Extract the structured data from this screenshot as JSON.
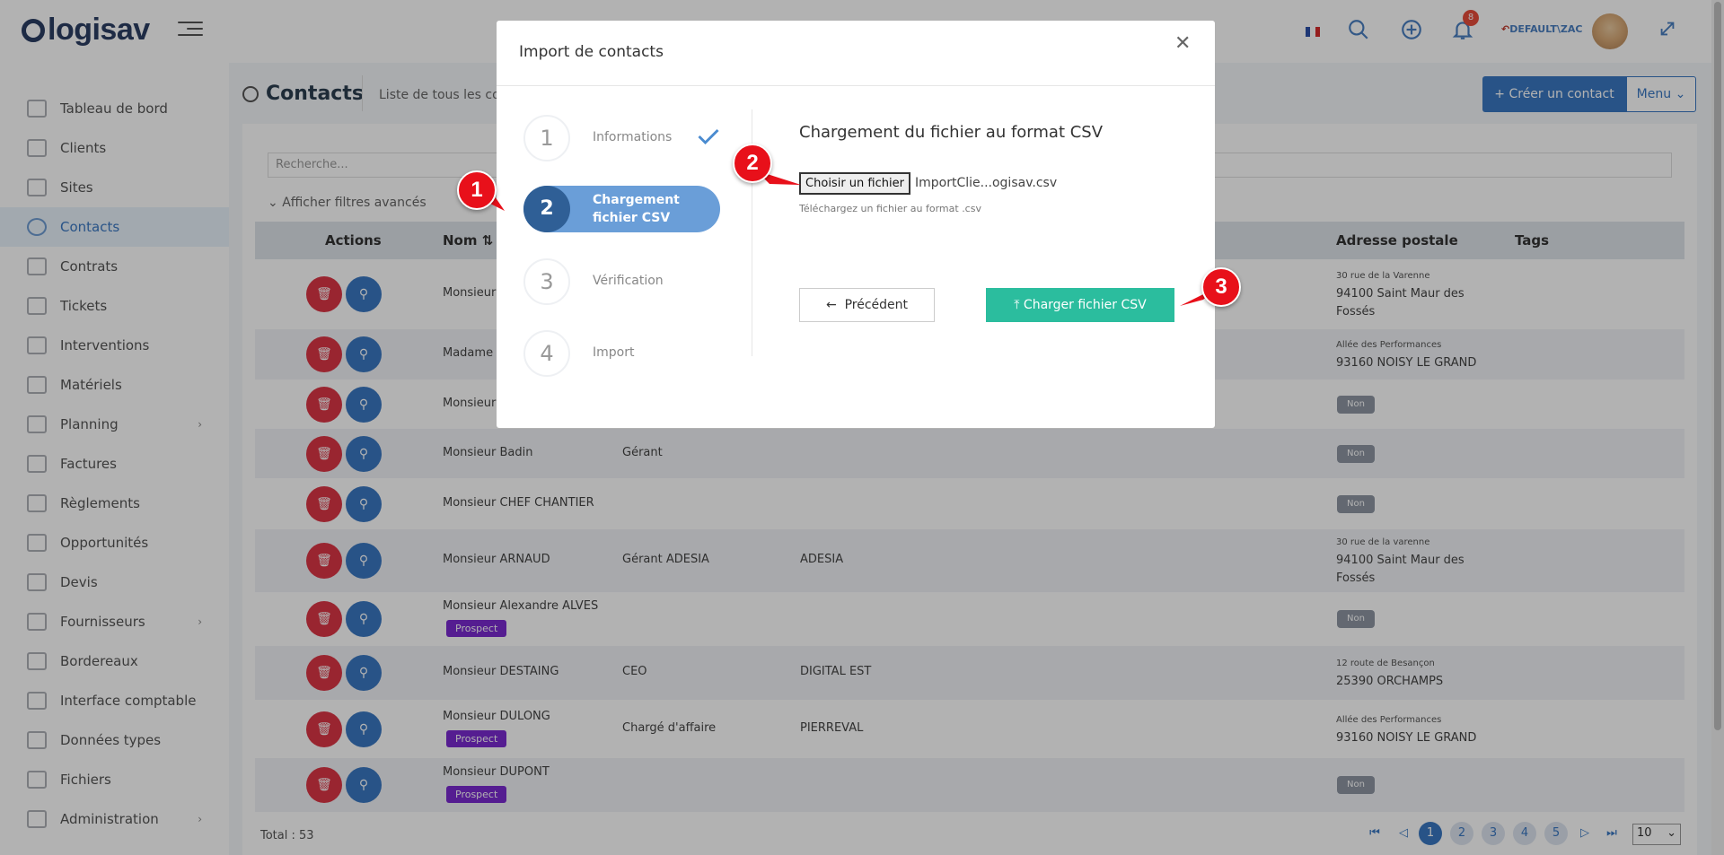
{
  "header": {
    "logo": "logisav",
    "user": "DEFAULT\\ZAC",
    "notification_count": "8"
  },
  "sidebar": {
    "items": [
      {
        "label": "Tableau de bord"
      },
      {
        "label": "Clients"
      },
      {
        "label": "Sites"
      },
      {
        "label": "Contacts"
      },
      {
        "label": "Contrats"
      },
      {
        "label": "Tickets"
      },
      {
        "label": "Interventions"
      },
      {
        "label": "Matériels"
      },
      {
        "label": "Planning"
      },
      {
        "label": "Factures"
      },
      {
        "label": "Règlements"
      },
      {
        "label": "Opportunités"
      },
      {
        "label": "Devis"
      },
      {
        "label": "Fournisseurs"
      },
      {
        "label": "Bordereaux"
      },
      {
        "label": "Interface comptable"
      },
      {
        "label": "Données types"
      },
      {
        "label": "Fichiers"
      },
      {
        "label": "Administration"
      }
    ]
  },
  "page": {
    "title": "Contacts",
    "subtitle": "Liste de tous les cont",
    "create_button": "Créer un contact",
    "menu_button": "Menu",
    "search_placeholder": "Recherche...",
    "filters_link": "Afficher filtres avancés",
    "columns": {
      "actions": "Actions",
      "nom": "Nom",
      "adresse": "Adresse postale",
      "tags": "Tags"
    },
    "rows": [
      {
        "nom": "Monsieur",
        "fonction": "",
        "societe": "",
        "addr1": "30 rue de la Varenne",
        "addr2": "94100 Saint Maur des",
        "addr3": "Fossés",
        "prospect": "",
        "non": ""
      },
      {
        "nom": "Madame",
        "fonction": "",
        "societe": "",
        "addr1": "Allée des Performances",
        "addr2": "93160 NOISY LE GRAND",
        "addr3": "",
        "prospect": "",
        "non": ""
      },
      {
        "nom": "Monsieur",
        "fonction": "",
        "societe": "",
        "addr1": "",
        "addr2": "",
        "addr3": "",
        "prospect": "",
        "non": "Non"
      },
      {
        "nom": "Monsieur Badin",
        "fonction": "Gérant",
        "societe": "",
        "addr1": "",
        "addr2": "",
        "addr3": "",
        "prospect": "",
        "non": "Non"
      },
      {
        "nom": "Monsieur CHEF CHANTIER",
        "fonction": "",
        "societe": "",
        "addr1": "",
        "addr2": "",
        "addr3": "",
        "prospect": "",
        "non": "Non"
      },
      {
        "nom": "Monsieur ARNAUD",
        "fonction": "Gérant ADESIA",
        "societe": "ADESIA",
        "addr1": "30 rue de la varenne",
        "addr2": "94100 Saint Maur des",
        "addr3": "Fossés",
        "prospect": "",
        "non": ""
      },
      {
        "nom": "Monsieur Alexandre ALVES",
        "fonction": "",
        "societe": "",
        "addr1": "",
        "addr2": "",
        "addr3": "",
        "prospect": "Prospect",
        "non": "Non"
      },
      {
        "nom": "Monsieur DESTAING",
        "fonction": "CEO",
        "societe": "DIGITAL EST",
        "addr1": "12 route de Besançon",
        "addr2": "25390 ORCHAMPS",
        "addr3": "",
        "prospect": "",
        "non": ""
      },
      {
        "nom": "Monsieur DULONG",
        "fonction": "Chargé d'affaire",
        "societe": "PIERREVAL",
        "addr1": "Allée des Performances",
        "addr2": "93160 NOISY LE GRAND",
        "addr3": "",
        "prospect": "Prospect",
        "non": ""
      },
      {
        "nom": "Monsieur DUPONT",
        "fonction": "",
        "societe": "",
        "addr1": "",
        "addr2": "",
        "addr3": "",
        "prospect": "Prospect",
        "non": "Non"
      }
    ],
    "total": "Total : 53",
    "pages": [
      "1",
      "2",
      "3",
      "4",
      "5"
    ],
    "page_size": "10"
  },
  "modal": {
    "title": "Import de contacts",
    "steps": [
      {
        "num": "1",
        "label": "Informations"
      },
      {
        "num": "2",
        "label": "Chargement fichier CSV"
      },
      {
        "num": "3",
        "label": "Vérification"
      },
      {
        "num": "4",
        "label": "Import"
      }
    ],
    "upload_title": "Chargement du fichier au format CSV",
    "file_button": "Choisir un fichier",
    "file_name": "ImportClie...ogisav.csv",
    "file_hint": "Téléchargez un fichier au format .csv",
    "prev_button": "Précédent",
    "upload_button": "Charger fichier CSV"
  },
  "callouts": [
    "1",
    "2",
    "3"
  ],
  "colors": {
    "primary": "#3a78c2",
    "danger": "#dc3545",
    "success": "#2bbd9e",
    "prospect": "#7a2ad0",
    "callout": "#e8101a"
  }
}
